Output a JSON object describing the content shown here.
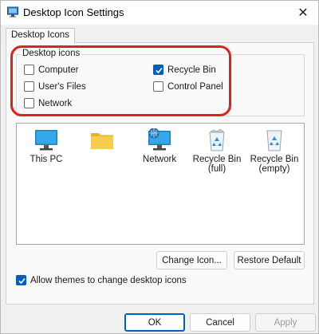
{
  "window": {
    "title": "Desktop Icon Settings",
    "close_symbol": "✕"
  },
  "tab": {
    "label": "Desktop Icons"
  },
  "group": {
    "legend": "Desktop icons",
    "checkboxes": [
      {
        "label": "Computer",
        "checked": false
      },
      {
        "label": "User's Files",
        "checked": false
      },
      {
        "label": "Network",
        "checked": false
      },
      {
        "label": "Recycle Bin",
        "checked": true
      },
      {
        "label": "Control Panel",
        "checked": false
      }
    ]
  },
  "icons": [
    {
      "label": "This PC",
      "icon": "monitor-icon"
    },
    {
      "label": "",
      "icon": "folder-icon"
    },
    {
      "label": "Network",
      "icon": "network-icon"
    },
    {
      "label": "Recycle Bin\n(full)",
      "icon": "recycle-bin-full-icon"
    },
    {
      "label": "Recycle Bin\n(empty)",
      "icon": "recycle-bin-empty-icon"
    }
  ],
  "buttons": {
    "change_icon": "Change Icon...",
    "restore_default": "Restore Default",
    "ok": "OK",
    "cancel": "Cancel",
    "apply": "Apply"
  },
  "allow_themes": {
    "label": "Allow themes to change desktop icons",
    "checked": true
  },
  "colors": {
    "accent": "#005fb8",
    "highlight": "#e0201b"
  }
}
